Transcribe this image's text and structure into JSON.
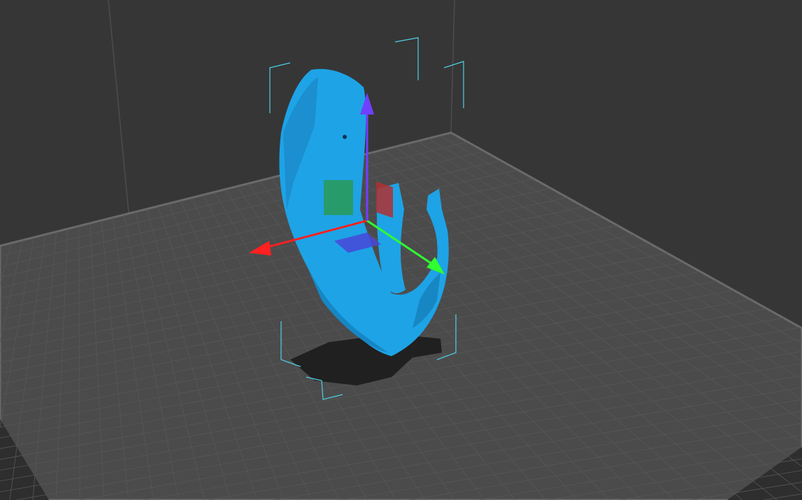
{
  "viewport": {
    "background_color": "#363636",
    "bed_color": "#4b4b4b",
    "bed_edge_color": "#6a6a6a",
    "grid_color": "#575757",
    "model_color": "#1ea3e6",
    "model_shadow_color": "#1b7fb8",
    "bounding_box_color": "#4fd0e6",
    "gizmo": {
      "x_axis_color": "#ff2020",
      "y_axis_color": "#30ff30",
      "z_axis_color": "#7040ff"
    }
  }
}
